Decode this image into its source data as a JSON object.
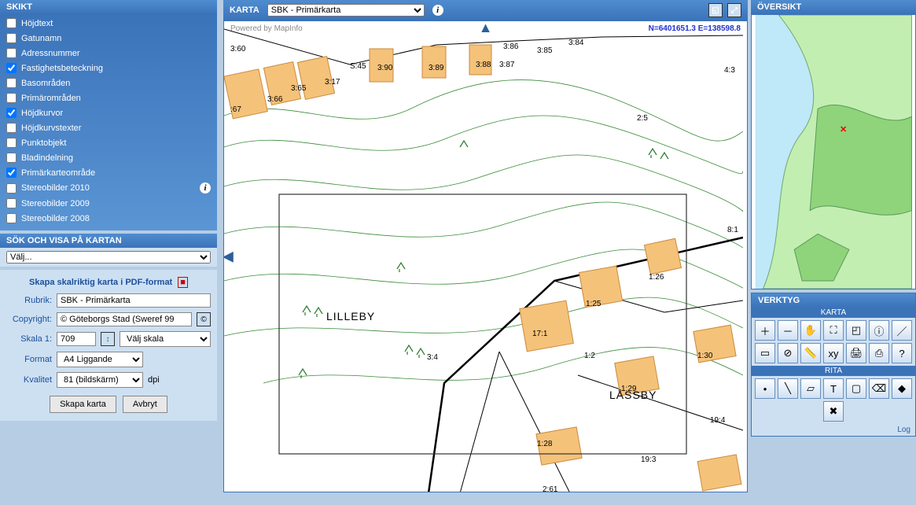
{
  "left": {
    "skikt_title": "SKIKT",
    "layers": [
      {
        "label": "Höjdtext",
        "checked": false
      },
      {
        "label": "Gatunamn",
        "checked": false
      },
      {
        "label": "Adressnummer",
        "checked": false
      },
      {
        "label": "Fastighetsbeteckning",
        "checked": true
      },
      {
        "label": "Basområden",
        "checked": false
      },
      {
        "label": "Primärområden",
        "checked": false
      },
      {
        "label": "Höjdkurvor",
        "checked": true
      },
      {
        "label": "Höjdkurvstexter",
        "checked": false
      },
      {
        "label": "Punktobjekt",
        "checked": false
      },
      {
        "label": "Bladindelning",
        "checked": false
      },
      {
        "label": "Primärkarteområde",
        "checked": true
      },
      {
        "label": "Stereobilder 2010",
        "checked": false,
        "info": true
      },
      {
        "label": "Stereobilder 2009",
        "checked": false
      },
      {
        "label": "Stereobilder 2008",
        "checked": false
      }
    ],
    "search_title": "SÖK OCH VISA PÅ KARTAN",
    "search_value": "Välj...",
    "pdf": {
      "title": "Skapa skalriktig karta i PDF-format",
      "rubrik_label": "Rubrik:",
      "rubrik_value": "SBK - Primärkarta",
      "copyright_label": "Copyright:",
      "copyright_value": "© Göteborgs Stad (Sweref 99",
      "skala_label": "Skala 1:",
      "skala_value": "709",
      "valjskala_label": "Välj skala",
      "format_label": "Format",
      "format_value": "A4 Liggande",
      "kvalitet_label": "Kvalitet",
      "kvalitet_value": "81 (bildskärm)",
      "kvalitet_unit": "dpi",
      "create_btn": "Skapa karta",
      "cancel_btn": "Avbryt"
    }
  },
  "map": {
    "title": "KARTA",
    "dropdown": "SBK - Primärkarta",
    "attribution": "Powered by MapInfo",
    "coords": "N=6401651.3 E=138598.8",
    "labels": {
      "lilleby": "LILLEBY",
      "lassby": "LÅSSBY"
    },
    "parcels": [
      "3:60",
      "3:86",
      "3:85",
      "3:84",
      "3:90",
      "3:89",
      "3:88",
      "3:87",
      "S:45",
      "3:17",
      "3:65",
      "3:66",
      ":67",
      "4:3",
      "2:5",
      "8:1",
      "1:26",
      "1:25",
      "17:1",
      "1:2",
      "1:30",
      "1:29",
      "1:28",
      "19:4",
      "19:3",
      "2:61",
      "3:4"
    ]
  },
  "right": {
    "overview_title": "ÖVERSIKT",
    "tools_title": "VERKTYG",
    "sub_karta": "KARTA",
    "sub_rita": "RITA",
    "log": "Log",
    "tool_icons_karta": [
      "zoom-in",
      "zoom-out",
      "pan",
      "zoom-extent",
      "zoom-window",
      "info-point",
      "info-line",
      "info-area",
      "info-off",
      "measure",
      "coords",
      "print",
      "pdf",
      "help"
    ],
    "tool_icons_rita": [
      "draw-point",
      "draw-line",
      "draw-poly",
      "draw-text",
      "draw-rect",
      "erase",
      "color",
      "delete"
    ]
  }
}
